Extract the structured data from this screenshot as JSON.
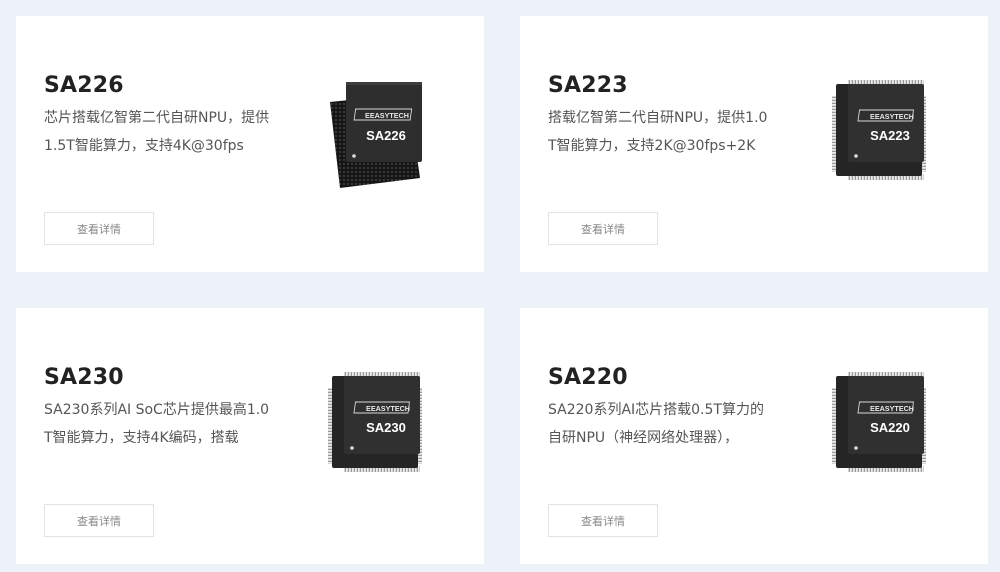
{
  "cards": [
    {
      "title": "SA226",
      "desc": "芯片搭载亿智第二代自研NPU，提供1.5T智能算力，支持4K@30fps",
      "button_label": "查看详情",
      "chip": {
        "brand": "EEASYTECH",
        "model": "SA226",
        "style": "bga"
      }
    },
    {
      "title": "SA223",
      "desc": "搭载亿智第二代自研NPU，提供1.0T智能算力，支持2K@30fps+2K",
      "button_label": "查看详情",
      "chip": {
        "brand": "EEASYTECH",
        "model": "SA223",
        "style": "qfp"
      }
    },
    {
      "title": "SA230",
      "desc": "SA230系列AI SoC芯片提供最高1.0T智能算力，支持4K编码，搭载",
      "button_label": "查看详情",
      "chip": {
        "brand": "EEASYTECH",
        "model": "SA230",
        "style": "qfp"
      }
    },
    {
      "title": "SA220",
      "desc": "SA220系列AI芯片搭载0.5T算力的自研NPU（神经网络处理器），",
      "button_label": "查看详情",
      "chip": {
        "brand": "EEASYTECH",
        "model": "SA220",
        "style": "qfp"
      }
    }
  ],
  "colors": {
    "page_background": "#edf1f8",
    "card_background": "#ffffff",
    "title_text": "#222222",
    "desc_text": "#555555",
    "button_text": "#888888",
    "button_border": "#e2e2e2",
    "chip_body": "#2b2b2b"
  }
}
